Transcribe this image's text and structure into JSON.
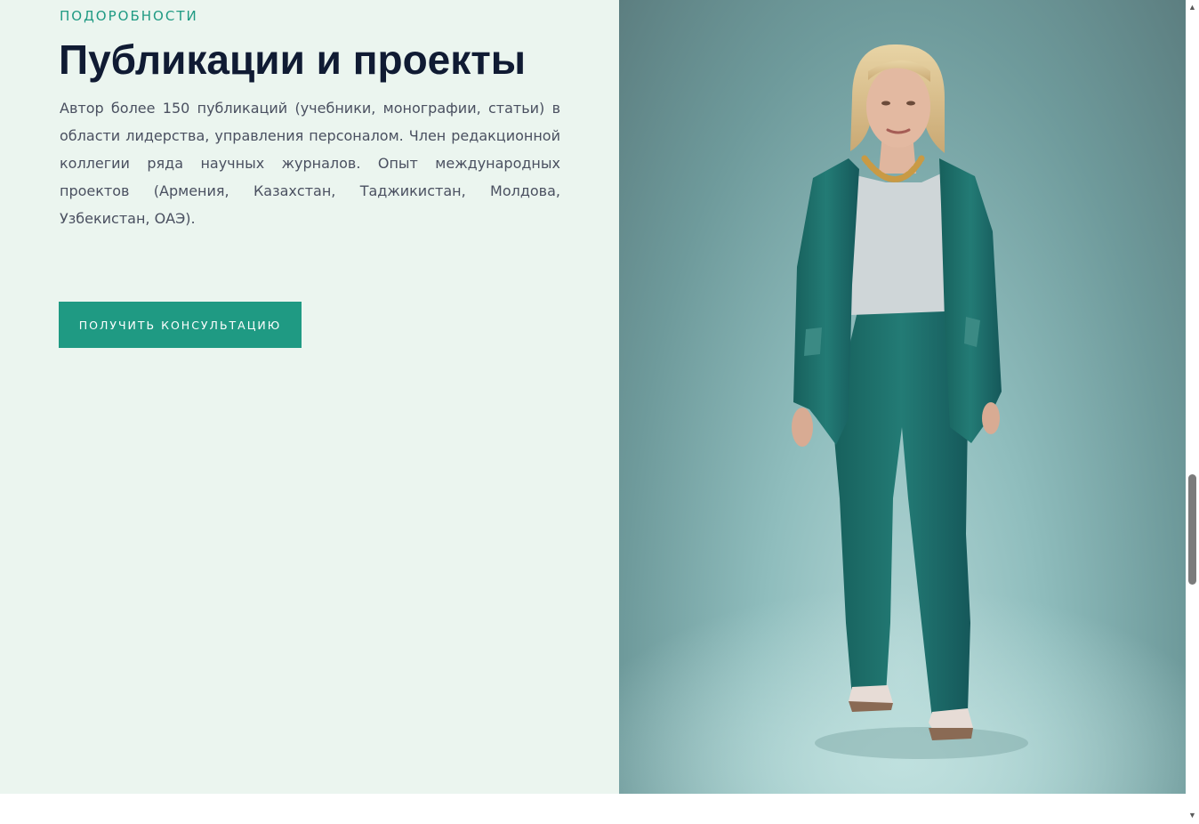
{
  "section": {
    "eyebrow": "ПОДОРОБНОСТИ",
    "title": "Публикации и проекты",
    "description": "Автор более 150 публикаций (учебники, монографии, статьи) в области лидерства, управления персоналом. Член редакционной коллегии ряда научных журналов. Опыт международных проектов (Армения, Казахстан, Таджикистан, Молдова, Узбекистан, ОАЭ).",
    "cta_label": "ПОЛУЧИТЬ КОНСУЛЬТАЦИЮ"
  },
  "colors": {
    "accent": "#1f9a83",
    "heading": "#101b33",
    "panel_bg": "#ebf5ef",
    "suit": "#1e6e6a"
  },
  "scrollbar": {
    "up_icon": "▲",
    "down_icon": "▼"
  }
}
